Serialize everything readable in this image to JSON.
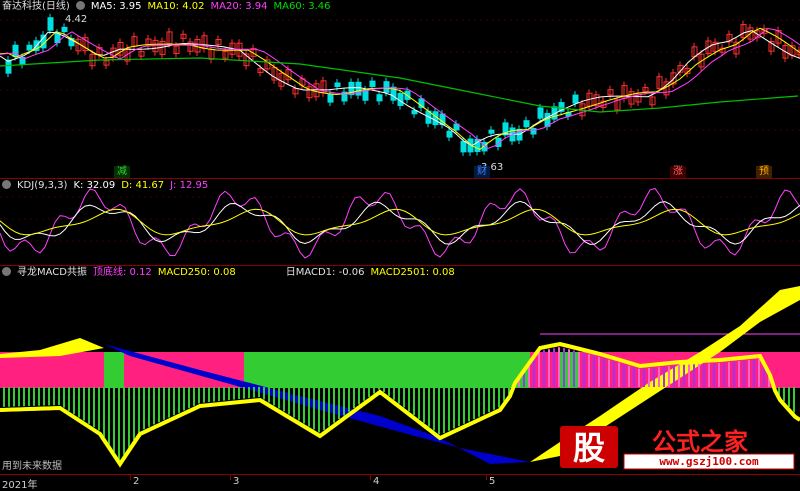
{
  "main_panel": {
    "title": "奋达科技(日线)",
    "ma5": "MA5: 3.95",
    "ma10": "MA10: 4.02",
    "ma20": "MA20: 3.94",
    "ma60": "MA60: 3.46",
    "high_label": "4.42",
    "low_label": "3.63",
    "markers": [
      "减",
      "财",
      "涨",
      "预"
    ]
  },
  "kdj_panel": {
    "title": "KDJ(9,3,3)",
    "k": "K: 32.09",
    "d": "D: 41.67",
    "j": "J: 12.95"
  },
  "macd_panel": {
    "title": "寻龙MACD共振",
    "top_line": "顶底线: 0.12",
    "macd250": "MACD250: 0.08",
    "daily1": "日MACD1: -0.06",
    "daily2": "MACD2501: 0.08",
    "future_note": "用到未来数据"
  },
  "axis": {
    "labels": [
      "2021年",
      "2",
      "3",
      "4",
      "5"
    ]
  },
  "watermark": {
    "big_char": "股",
    "title": "公式之家",
    "url": "www.gszj100.com"
  },
  "colors": {
    "up": "#ff3030",
    "down": "#00e0e0",
    "ma5": "#ffffff",
    "ma10": "#ffff00",
    "ma20": "#ff40ff",
    "ma60": "#00c000",
    "yellow": "#ffff00",
    "blue": "#0000cc",
    "green": "#33cc33",
    "pink": "#ff2080"
  }
}
